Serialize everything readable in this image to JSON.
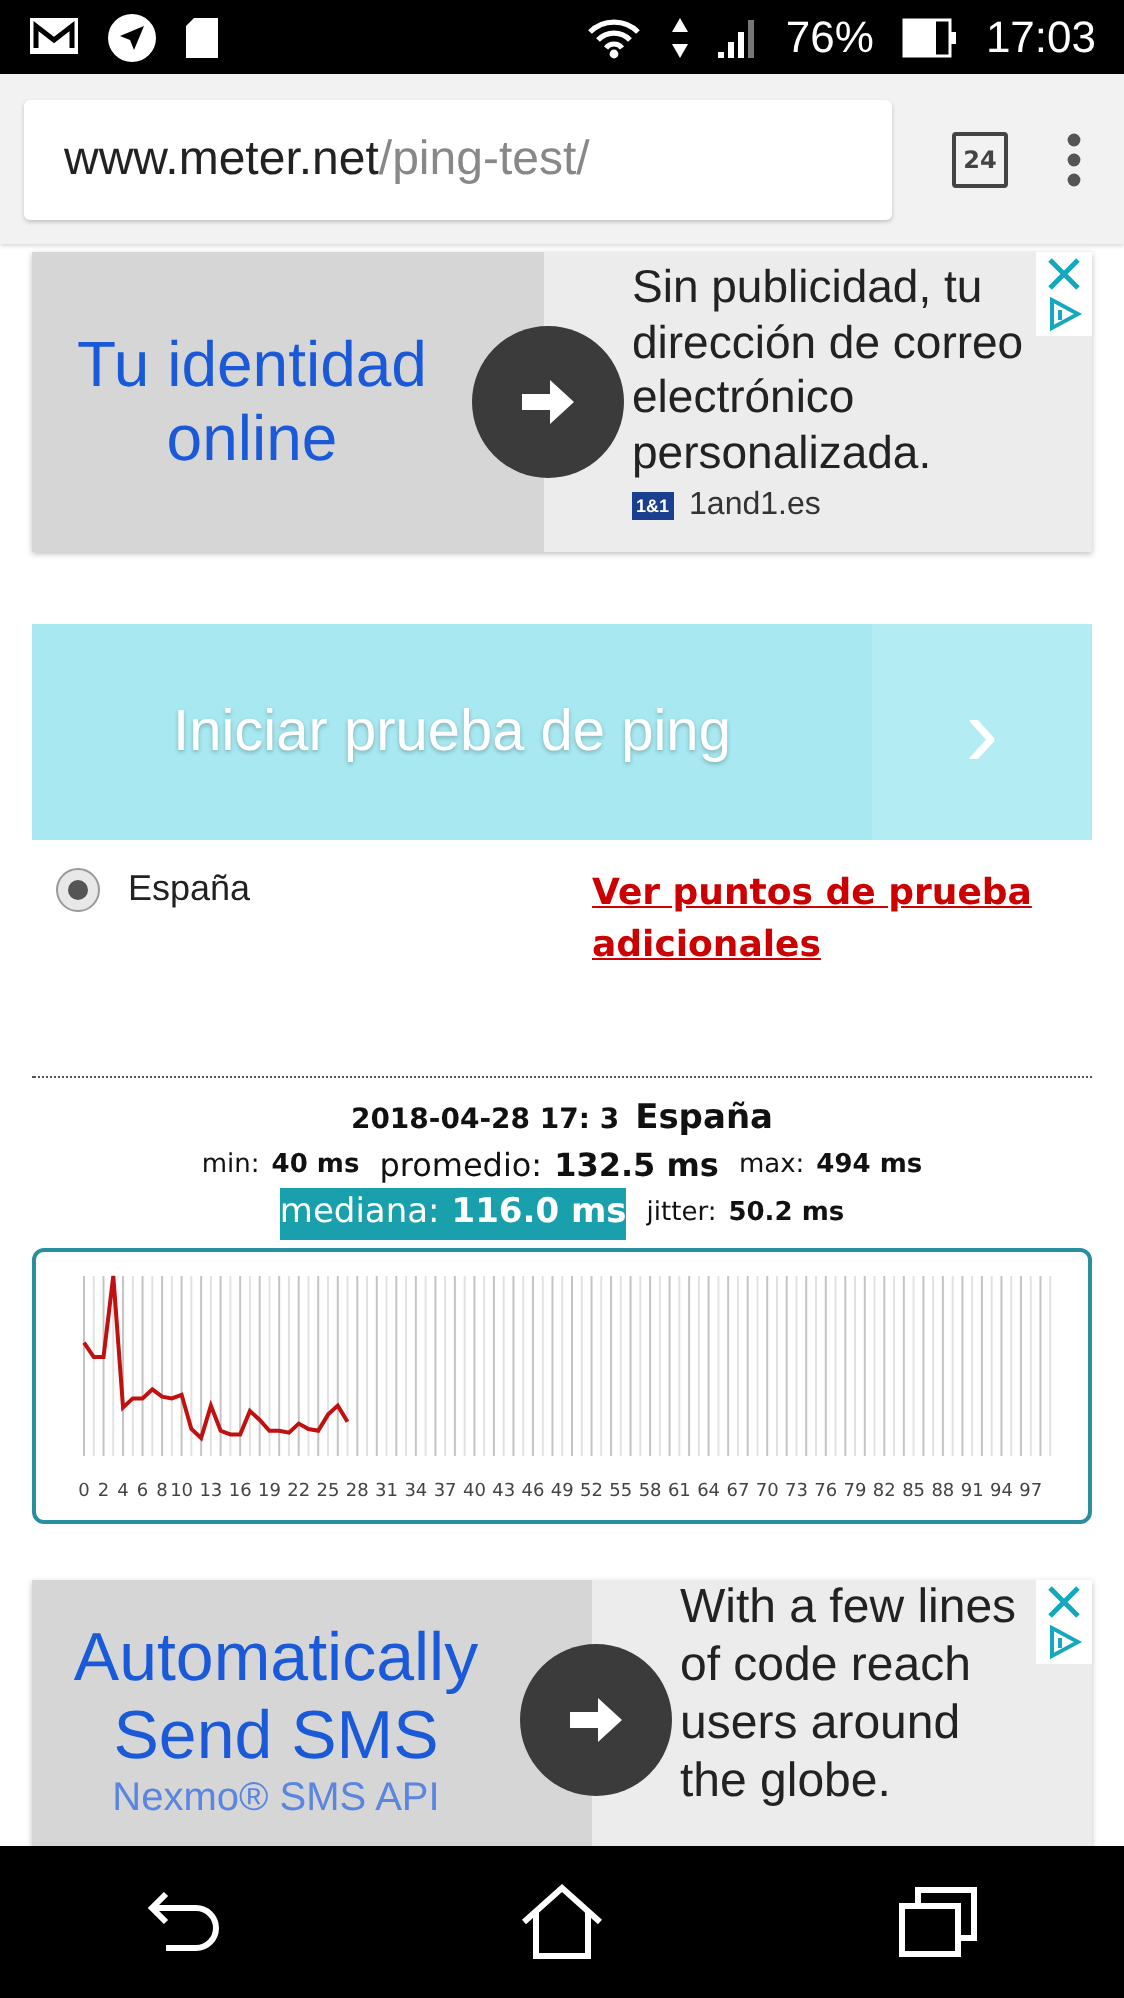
{
  "status_bar": {
    "battery": "76%",
    "time": "17:03"
  },
  "browser": {
    "url_host": "www.meter.net",
    "url_path": "/ping-test/",
    "tab_count": "24"
  },
  "ads": [
    {
      "headline": [
        "Tu identidad",
        "online"
      ],
      "body": "Sin publicidad, tu dirección de correo electrónico personalizada.",
      "source": "1and1.es",
      "source_logo": "1&1"
    },
    {
      "headline": [
        "Automatically",
        "Send SMS"
      ],
      "subline": "Nexmo® SMS API",
      "body": "With a few lines of code reach users around the globe."
    }
  ],
  "start_button": {
    "label": "Iniciar prueba de ping",
    "chevron": "›"
  },
  "locations": [
    {
      "label": "España",
      "selected": true
    }
  ],
  "more_points_link": "Ver puntos de prueba adicionales",
  "result": {
    "timestamp": "2018-04-28 17: 3",
    "location": "España",
    "stats": [
      {
        "kind": "plain",
        "label": "min:",
        "value": "40 ms"
      },
      {
        "kind": "large",
        "label": "promedio:",
        "value": "132.5 ms"
      },
      {
        "kind": "plain",
        "label": "max:",
        "value": "494 ms"
      },
      {
        "kind": "highlight",
        "label": "mediana:",
        "value": "116.0 ms"
      },
      {
        "kind": "plain",
        "label": "jitter:",
        "value": "50.2 ms"
      }
    ],
    "x_labels": [
      "0",
      "2",
      "4",
      "6",
      "8",
      "10",
      "13",
      "16",
      "19",
      "22",
      "25",
      "28",
      "31",
      "34",
      "37",
      "40",
      "43",
      "46",
      "49",
      "52",
      "55",
      "58",
      "61",
      "64",
      "67",
      "70",
      "73",
      "76",
      "79",
      "82",
      "85",
      "88",
      "91",
      "94",
      "97"
    ]
  }
}
